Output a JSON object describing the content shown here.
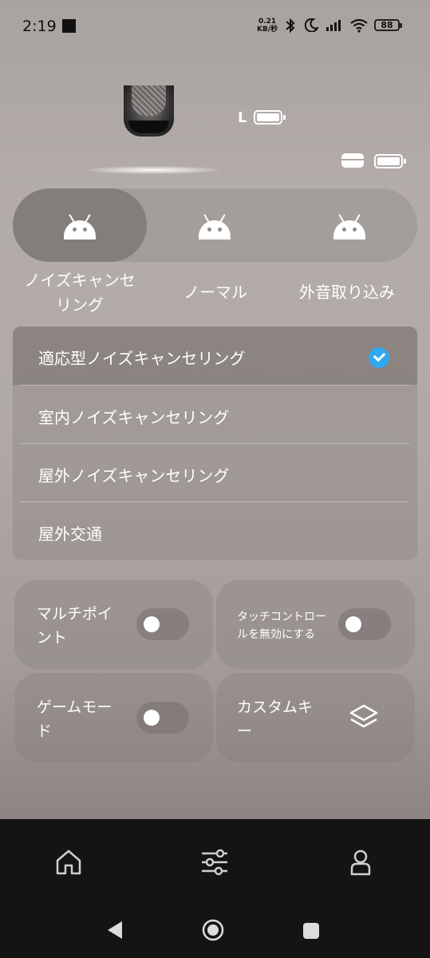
{
  "status_bar": {
    "time": "2:19",
    "net_speed_value": "0.21",
    "net_speed_unit": "KB/秒",
    "battery": "88"
  },
  "device": {
    "side_label": "L"
  },
  "modes": [
    {
      "label_line1": "ノイズキャンセ",
      "label_line2": "リング",
      "selected": true
    },
    {
      "label_line1": "ノーマル",
      "label_line2": "",
      "selected": false
    },
    {
      "label_line1": "外音取り込み",
      "label_line2": "",
      "selected": false
    }
  ],
  "anc_options": [
    {
      "label": "適応型ノイズキャンセリング",
      "selected": true
    },
    {
      "label": "室内ノイズキャンセリング",
      "selected": false
    },
    {
      "label": "屋外ノイズキャンセリング",
      "selected": false
    },
    {
      "label": "屋外交通",
      "selected": false
    }
  ],
  "cards": {
    "multipoint": {
      "line1": "マルチポイ",
      "line2": "ント",
      "enabled": false
    },
    "touch_control": {
      "line1": "タッチコントロー",
      "line2": "ルを無効にする",
      "enabled": false
    },
    "game_mode": {
      "line1": "ゲームモー",
      "line2": "ド",
      "enabled": false
    },
    "custom_key": {
      "line1": "カスタムキ",
      "line2": "ー"
    }
  },
  "colors": {
    "accent": "#2fa8f0",
    "nav_background": "#141414"
  },
  "icons": {
    "mode": "android-icon",
    "custom_key": "layers-icon",
    "nav_home": "home-icon",
    "nav_settings": "sliders-icon",
    "nav_profile": "person-icon"
  }
}
